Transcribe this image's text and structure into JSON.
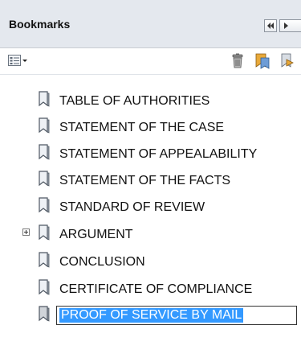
{
  "header": {
    "title": "Bookmarks"
  },
  "toolbar": {
    "icons": [
      "options-menu-icon",
      "delete-bookmark-icon",
      "new-bookmark-icon",
      "new-bookmark-from-structure-icon"
    ]
  },
  "bookmarks": [
    {
      "label": "TABLE OF AUTHORITIES"
    },
    {
      "label": "STATEMENT OF THE CASE"
    },
    {
      "label": "STATEMENT OF APPEALABILITY"
    },
    {
      "label": "STATEMENT OF THE FACTS"
    },
    {
      "label": "STANDARD OF REVIEW"
    },
    {
      "label": "ARGUMENT",
      "expandable": true
    },
    {
      "label": "CONCLUSION"
    },
    {
      "label": "CERTIFICATE OF COMPLIANCE"
    },
    {
      "label": "PROOF OF SERVICE BY MAIL",
      "editing": true
    }
  ],
  "colors": {
    "selection": "#3399ff",
    "header_bg": "#e4e8ee"
  }
}
